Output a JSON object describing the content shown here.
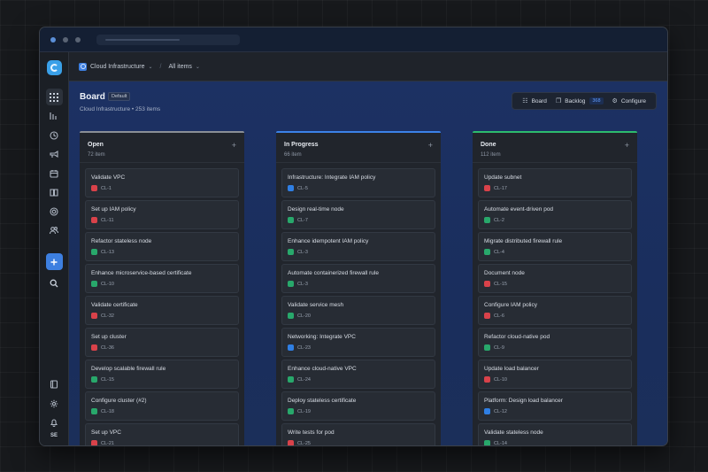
{
  "sidebar": {
    "user_initials": "SE"
  },
  "breadcrumb": {
    "project": "Cloud Infrastructure",
    "view": "All items"
  },
  "board": {
    "title": "Board",
    "badge": "Default",
    "subtitle": "Cloud Infrastructure • 253 items"
  },
  "toolbar": {
    "board": "Board",
    "backlog": "Backlog",
    "backlog_count": "368",
    "configure": "Configure"
  },
  "columns": [
    {
      "title": "Open",
      "count": "72 item",
      "cards": [
        {
          "title": "Validate VPC",
          "id": "CL-1",
          "type": "bug"
        },
        {
          "title": "Set up IAM policy",
          "id": "CL-11",
          "type": "bug"
        },
        {
          "title": "Refactor stateless node",
          "id": "CL-13",
          "type": "story"
        },
        {
          "title": "Enhance microservice-based certificate",
          "id": "CL-10",
          "type": "story"
        },
        {
          "title": "Validate certificate",
          "id": "CL-32",
          "type": "bug"
        },
        {
          "title": "Set up cluster",
          "id": "CL-36",
          "type": "bug"
        },
        {
          "title": "Develop scalable firewall rule",
          "id": "CL-15",
          "type": "story"
        },
        {
          "title": "Configure cluster (#2)",
          "id": "CL-18",
          "type": "story"
        },
        {
          "title": "Set up VPC",
          "id": "CL-21",
          "type": "bug"
        }
      ]
    },
    {
      "title": "In Progress",
      "count": "66 item",
      "cards": [
        {
          "title": "Infrastructure: Integrate IAM policy",
          "id": "CL-5",
          "type": "feature"
        },
        {
          "title": "Design real-time node",
          "id": "CL-7",
          "type": "story"
        },
        {
          "title": "Enhance idempotent IAM policy",
          "id": "CL-3",
          "type": "story"
        },
        {
          "title": "Automate containerized firewall rule",
          "id": "CL-3",
          "type": "story"
        },
        {
          "title": "Validate service mesh",
          "id": "CL-20",
          "type": "story"
        },
        {
          "title": "Networking: Integrate VPC",
          "id": "CL-23",
          "type": "feature"
        },
        {
          "title": "Enhance cloud-native VPC",
          "id": "CL-24",
          "type": "story"
        },
        {
          "title": "Deploy stateless certificate",
          "id": "CL-19",
          "type": "story"
        },
        {
          "title": "Write tests for pod",
          "id": "CL-25",
          "type": "bug"
        }
      ]
    },
    {
      "title": "Done",
      "count": "112 item",
      "cards": [
        {
          "title": "Update subnet",
          "id": "CL-17",
          "type": "bug"
        },
        {
          "title": "Automate event-driven pod",
          "id": "CL-2",
          "type": "story"
        },
        {
          "title": "Migrate distributed firewall rule",
          "id": "CL-4",
          "type": "story"
        },
        {
          "title": "Document node",
          "id": "CL-15",
          "type": "bug"
        },
        {
          "title": "Configure IAM policy",
          "id": "CL-6",
          "type": "bug"
        },
        {
          "title": "Refactor cloud-native pod",
          "id": "CL-9",
          "type": "story"
        },
        {
          "title": "Update load balancer",
          "id": "CL-10",
          "type": "bug"
        },
        {
          "title": "Platform: Design load balancer",
          "id": "CL-12",
          "type": "feature"
        },
        {
          "title": "Validate stateless node",
          "id": "CL-14",
          "type": "story"
        }
      ]
    }
  ]
}
